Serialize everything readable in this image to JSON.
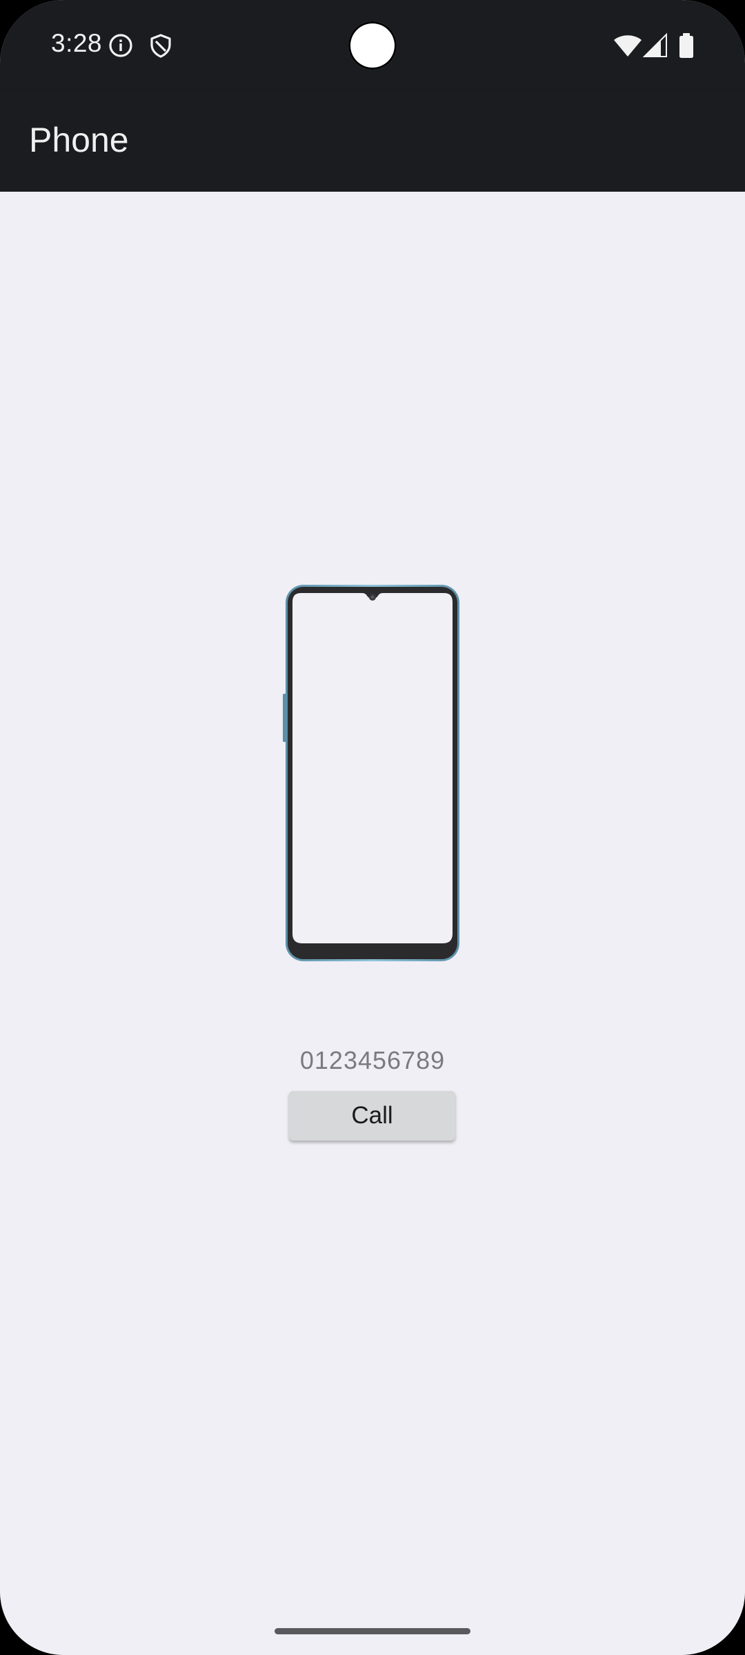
{
  "status_bar": {
    "time": "3:28",
    "left_icons": [
      "info-icon",
      "shield-icon"
    ],
    "right_icons": [
      "wifi-icon",
      "cellular-signal-icon",
      "battery-icon"
    ]
  },
  "app_bar": {
    "title": "Phone"
  },
  "main": {
    "image": "phone-device-illustration",
    "phone_number": "0123456789",
    "call_button_label": "Call"
  },
  "colors": {
    "bar_background": "#1b1c20",
    "page_background": "#efeff5",
    "button_background": "#d7d8d9",
    "number_text": "#7a7a80"
  }
}
